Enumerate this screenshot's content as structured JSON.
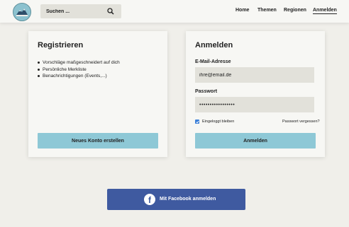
{
  "header": {
    "search_placeholder": "Suchen ...",
    "nav": [
      "Home",
      "Themen",
      "Regionen",
      "Anmelden"
    ],
    "active_nav": "Anmelden"
  },
  "register": {
    "title": "Registrieren",
    "bullets": [
      "Vorschläge maßgeschneidert auf dich",
      "Persönliche Merkliste",
      "Benachrichtigungen (Events,...)"
    ],
    "button": "Neues Konto erstellen"
  },
  "login": {
    "title": "Anmelden",
    "email_label": "E-Mail-Adresse",
    "email_value": "ihre@email.de",
    "password_label": "Passwort",
    "password_value": "•••••••••••••••••",
    "remember_label": "Eingeloggt bleiben",
    "remember_checked": true,
    "forgot_link": "Passwort vergessen?",
    "button": "Anmelden"
  },
  "facebook": {
    "button": "Mit Facebook anmelden",
    "icon_glyph": "f"
  },
  "colors": {
    "accent": "#8ec8d6",
    "facebook": "#3f5aa0",
    "checkbox": "#3b7fd8",
    "background": "#f0efea"
  }
}
